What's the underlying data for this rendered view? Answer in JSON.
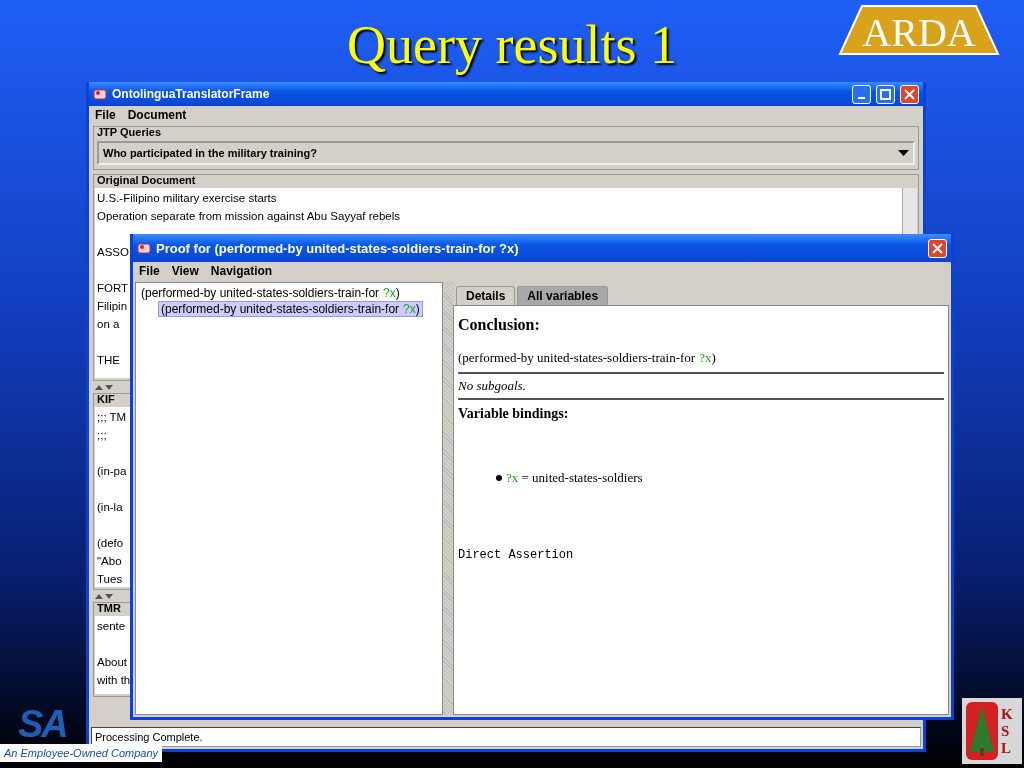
{
  "slide": {
    "title": "Query results 1",
    "logo_top": "ARDA",
    "logo_bottom": {
      "mark": "SA",
      "tagline": "An Employee-Owned Company"
    },
    "logo_corner": [
      "K",
      "S",
      "L"
    ]
  },
  "main_window": {
    "title": "OntolinguaTranslatorFrame",
    "menu": [
      "File",
      "Document"
    ],
    "queries": {
      "label": "JTP Queries",
      "value": "Who participated in the military training?"
    },
    "panels": [
      {
        "label": "Original Document",
        "scrollbar": true,
        "paragraphs": [
          [
            "U.S.-Filipino military exercise starts",
            "Operation separate from mission against Abu Sayyaf rebels"
          ],
          [
            "ASSO"
          ],
          [
            "FORT",
            "Filipin",
            "on a"
          ],
          [
            "THE"
          ]
        ]
      },
      {
        "label": "KIF",
        "paragraphs": [
          [
            ";;; TM",
            ";;;"
          ],
          [
            "(in-pa"
          ],
          [
            "(in-la"
          ],
          [
            "(defo",
            "\"Abo",
            "Tues"
          ]
        ]
      },
      {
        "label": "TMR",
        "paragraphs": [
          [
            "sente"
          ],
          [
            "About",
            "with th"
          ]
        ]
      }
    ],
    "status": "Processing Complete."
  },
  "proof_window": {
    "title": "Proof for (performed-by united-states-soldiers-train-for ?x)",
    "menu": [
      "File",
      "View",
      "Navigation"
    ],
    "tree": [
      {
        "open": "(performed-by united-states-soldiers-train-for",
        "variable": "?x",
        "close": ")",
        "selected": false,
        "children": [
          {
            "open": "(performed-by united-states-soldiers-train-for",
            "variable": "?x",
            "close": ")",
            "selected": true
          }
        ]
      }
    ],
    "tabs": [
      {
        "label": "Details",
        "selected": true
      },
      {
        "label": "All variables",
        "selected": false
      }
    ],
    "details": {
      "heading": "Conclusion:",
      "conclusion": {
        "open": "(performed-by united-states-soldiers-train-for",
        "variable": "?x",
        "close": ")"
      },
      "subgoals": "No subgoals.",
      "bindings_heading": "Variable bindings:",
      "bindings": [
        {
          "variable": "?x",
          "value": "= united-states-soldiers"
        }
      ],
      "justification": "Direct Assertion"
    }
  }
}
